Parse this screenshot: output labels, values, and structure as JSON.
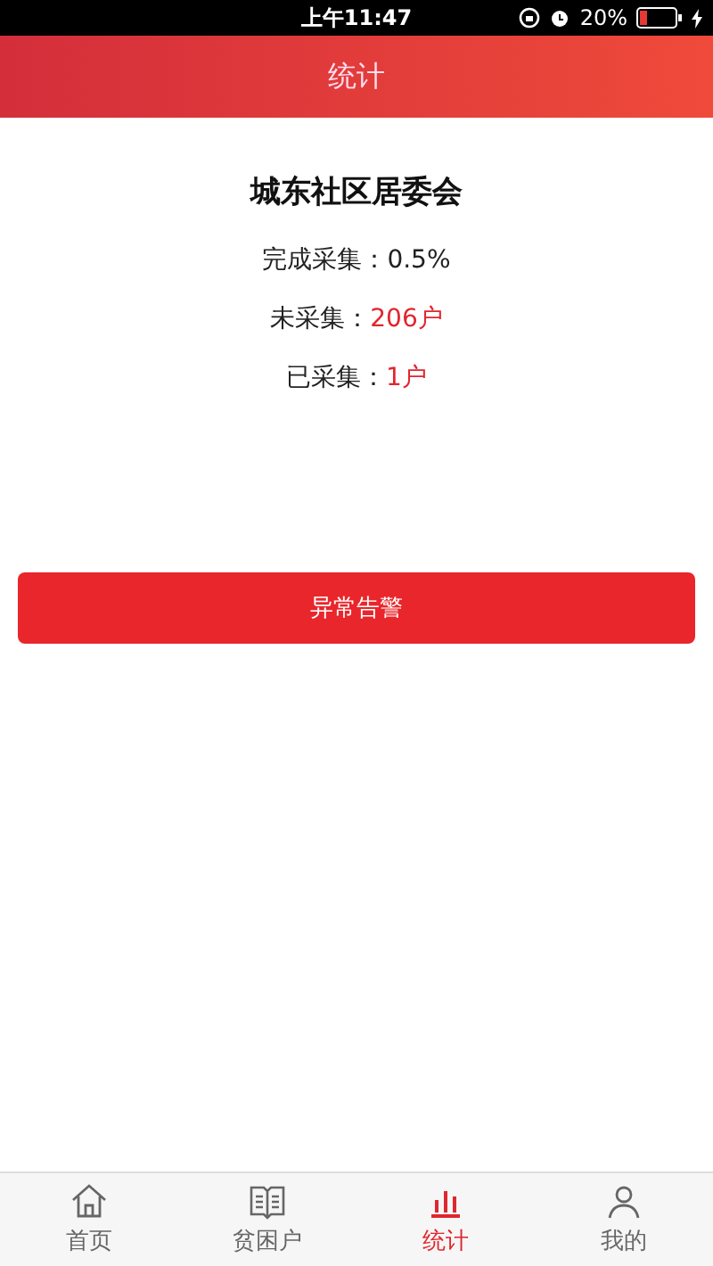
{
  "status_bar": {
    "time": "上午11:47",
    "battery": "20%"
  },
  "header": {
    "title": "统计"
  },
  "summary": {
    "title": "城东社区居委会",
    "rows": [
      {
        "label": "完成采集：",
        "value": "0.5%",
        "kind": "plain"
      },
      {
        "label": "未采集：",
        "value": "206户",
        "kind": "highlight"
      },
      {
        "label": "已采集：",
        "value": "1户",
        "kind": "highlight"
      }
    ]
  },
  "alert_button": "异常告警",
  "tabs": [
    {
      "label": "首页",
      "kind": "home",
      "selected": false
    },
    {
      "label": "贫困户",
      "kind": "book",
      "selected": false
    },
    {
      "label": "统计",
      "kind": "chart",
      "selected": true
    },
    {
      "label": "我的",
      "kind": "user",
      "selected": false
    }
  ]
}
